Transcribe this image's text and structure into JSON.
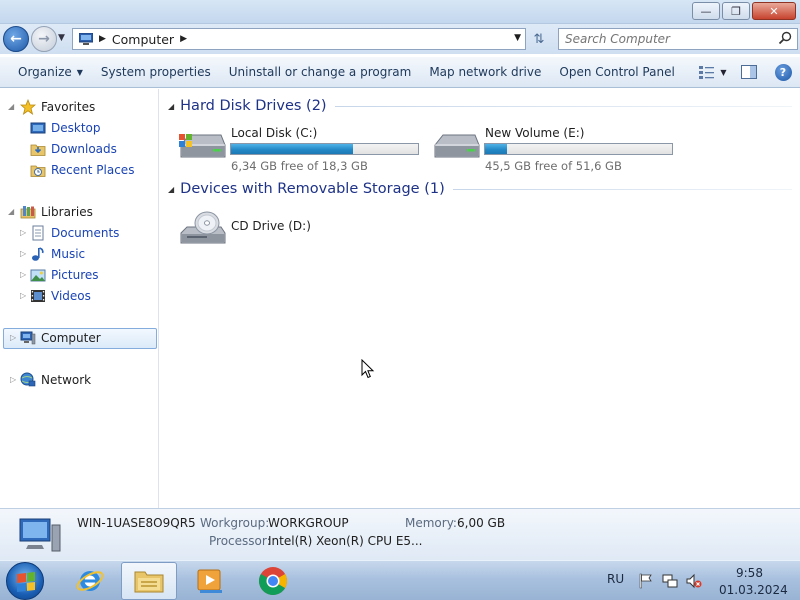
{
  "window": {
    "minimize_glyph": "—",
    "maximize_glyph": "❐",
    "close_glyph": "✕"
  },
  "address": {
    "crumb": "Computer",
    "back_icon": "back-arrow-icon",
    "forward_icon": "forward-arrow-icon"
  },
  "search": {
    "placeholder": "Search Computer"
  },
  "toolbar": {
    "organize": "Organize",
    "system_properties": "System properties",
    "uninstall": "Uninstall or change a program",
    "map_network": "Map network drive",
    "open_control_panel": "Open Control Panel",
    "help": "?"
  },
  "sidebar": {
    "favorites": "Favorites",
    "desktop": "Desktop",
    "downloads": "Downloads",
    "recent_places": "Recent Places",
    "libraries": "Libraries",
    "documents": "Documents",
    "music": "Music",
    "pictures": "Pictures",
    "videos": "Videos",
    "computer": "Computer",
    "network": "Network"
  },
  "main": {
    "hdd_group": "Hard Disk Drives (2)",
    "removable_group": "Devices with Removable Storage (1)",
    "drives": [
      {
        "name": "Local Disk (C:)",
        "free": "6,34 GB free of 18,3 GB",
        "used_fraction": 0.654
      },
      {
        "name": "New Volume (E:)",
        "free": "45,5 GB free of 51,6 GB",
        "used_fraction": 0.118
      }
    ],
    "cd": {
      "name": "CD Drive (D:)"
    }
  },
  "details": {
    "computer_name": "WIN-1UASE8O9QR5",
    "workgroup_label": "Workgroup:",
    "workgroup": "WORKGROUP",
    "memory_label": "Memory:",
    "memory": "6,00 GB",
    "processor_label": "Processor:",
    "processor": "Intel(R) Xeon(R) CPU E5..."
  },
  "taskbar": {
    "language": "RU",
    "time": "9:58",
    "date": "01.03.2024"
  },
  "colors": {
    "link_blue": "#1a44b5",
    "group_title": "#1e3287",
    "bar_fill": "#2489c7"
  }
}
